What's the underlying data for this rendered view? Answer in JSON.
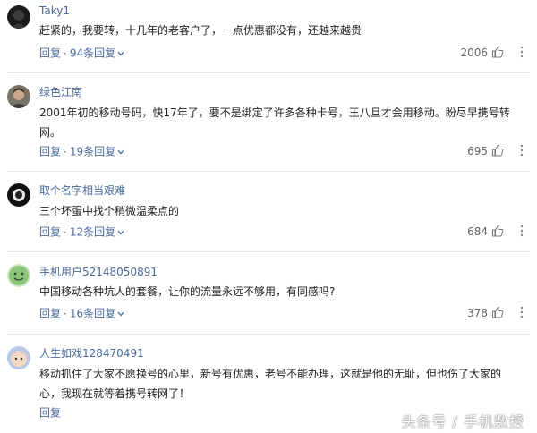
{
  "comments": [
    {
      "user": "Taky1",
      "avatar": "avatar-dark",
      "text": "赶紧的，我要转，十几年的老客户了，一点优惠都没有，还越来越贵",
      "reply_label": "回复",
      "reply_count": "94条回复",
      "likes": "2006"
    },
    {
      "user": "绿色江南",
      "avatar": "avatar-photo",
      "text": "2001年初的移动号码，快17年了，要不是绑定了许多各种卡号，王八旦才会用移动。盼尽早携号转网。",
      "reply_label": "回复",
      "reply_count": "19条回复",
      "likes": "695"
    },
    {
      "user": "取个名字相当艰难",
      "avatar": "avatar-dark",
      "text": "三个坏蛋中找个稍微温柔点的",
      "reply_label": "回复",
      "reply_count": "12条回复",
      "likes": "684"
    },
    {
      "user": "手机用户52148050891",
      "avatar": "avatar-face",
      "text": "中国移动各种坑人的套餐，让你的流量永远不够用，有同感吗?",
      "reply_label": "回复",
      "reply_count": "16条回复",
      "likes": "378"
    },
    {
      "user": "人生如戏128470491",
      "avatar": "avatar-cartoon",
      "text": "移动抓住了大家不愿换号的心里，新号有优惠，老号不能办理，这就是他的无耻，但也伤了大家的心，我现在就等着携号转网了！",
      "reply_label": "回复",
      "reply_count": "",
      "likes": ""
    }
  ],
  "watermark": "头条号 / 手机数授",
  "colors": {
    "link": "#4a6a9b",
    "text": "#222222",
    "muted": "#666666"
  }
}
